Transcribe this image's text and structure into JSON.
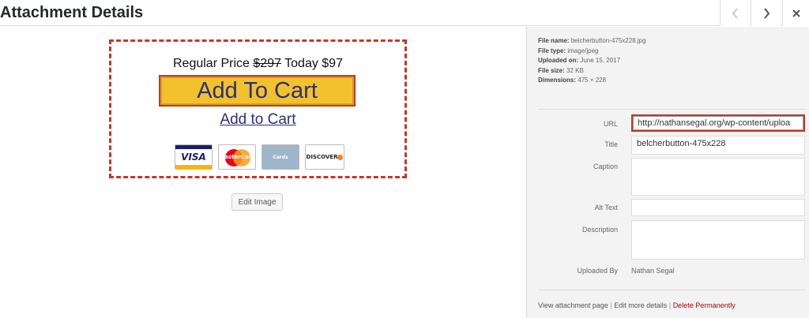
{
  "header": {
    "title": "Attachment Details",
    "prev_icon": "chevron-left-icon",
    "next_icon": "chevron-right-icon",
    "close_icon": "close-icon"
  },
  "preview": {
    "price_prefix": "Regular Price",
    "price_old": "$297",
    "price_suffix": "Today $97",
    "cart_button_label": "Add To Cart",
    "cart_link_label": "Add to Cart",
    "cards": {
      "visa": "VISA",
      "mastercard": "MasterCard",
      "amex": "Cards",
      "discover": "DISCOVER"
    },
    "edit_image_label": "Edit Image"
  },
  "meta": {
    "file_name_label": "File name:",
    "file_name": "belcherbutton-475x228.jpg",
    "file_type_label": "File type:",
    "file_type": "image/jpeg",
    "uploaded_on_label": "Uploaded on:",
    "uploaded_on": "June 15, 2017",
    "file_size_label": "File size:",
    "file_size": "32 KB",
    "dimensions_label": "Dimensions:",
    "dimensions": "475 × 228"
  },
  "fields": {
    "url_label": "URL",
    "url_value": "http://nathansegal.org/wp-content/uploa",
    "title_label": "Title",
    "title_value": "belcherbutton-475x228",
    "caption_label": "Caption",
    "caption_value": "",
    "alt_label": "Alt Text",
    "alt_value": "",
    "description_label": "Description",
    "description_value": "",
    "uploaded_by_label": "Uploaded By",
    "uploaded_by_value": "Nathan Segal"
  },
  "actions": {
    "view_page": "View attachment page",
    "separator": "|",
    "edit_details": "Edit more details",
    "delete": "Delete Permanently"
  },
  "colors": {
    "highlight": "#c0392b",
    "cart_button": "#f2c12e",
    "delete_link": "#aa0000"
  }
}
